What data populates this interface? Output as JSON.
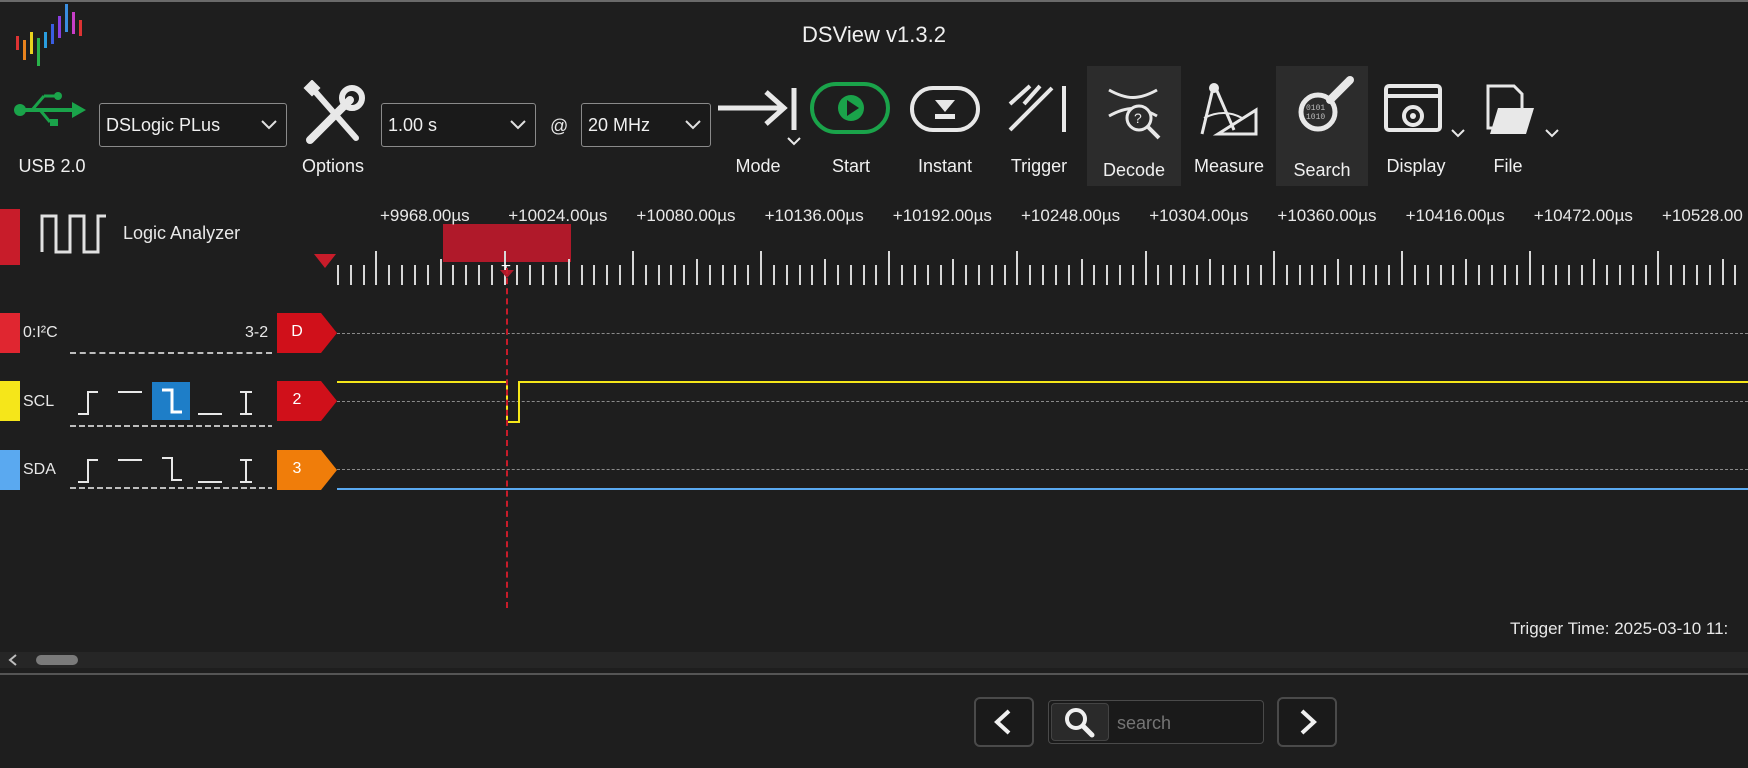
{
  "window": {
    "title": "DSView v1.3.2"
  },
  "toolbar": {
    "usb_label": "USB 2.0",
    "device": "DSLogic PLus",
    "options_label": "Options",
    "duration": "1.00 s",
    "at": "@",
    "rate": "20 MHz",
    "mode_label": "Mode",
    "start_label": "Start",
    "instant_label": "Instant",
    "trigger_label": "Trigger",
    "decode_label": "Decode",
    "measure_label": "Measure",
    "search_label": "Search",
    "display_label": "Display",
    "file_label": "File"
  },
  "colors": {
    "accent_green": "#1aa34a",
    "trigger_red": "#b0192a",
    "scl": "#f5e61a",
    "sda": "#5aa9f0",
    "decoder_tag": "#d0101a",
    "sda_tag": "#f07d0a"
  },
  "timeline": {
    "ticks": [
      "+9968.00µs",
      "+10024.00µs",
      "+10080.00µs",
      "+10136.00µs",
      "+10192.00µs",
      "+10248.00µs",
      "+10304.00µs",
      "+10360.00µs",
      "+10416.00µs",
      "+10472.00µs",
      "+10528.00"
    ],
    "trigger_marker": "T"
  },
  "analyzer": {
    "label": "Logic Analyzer"
  },
  "channels": {
    "decoder": {
      "name": "0:I²C",
      "range": "3-2",
      "tag": "D"
    },
    "scl": {
      "name": "SCL",
      "tag": "2"
    },
    "sda": {
      "name": "SDA",
      "tag": "3"
    }
  },
  "status": {
    "trigger_time": "Trigger Time: 2025-03-10 11:"
  },
  "searchbar": {
    "placeholder": "search"
  }
}
